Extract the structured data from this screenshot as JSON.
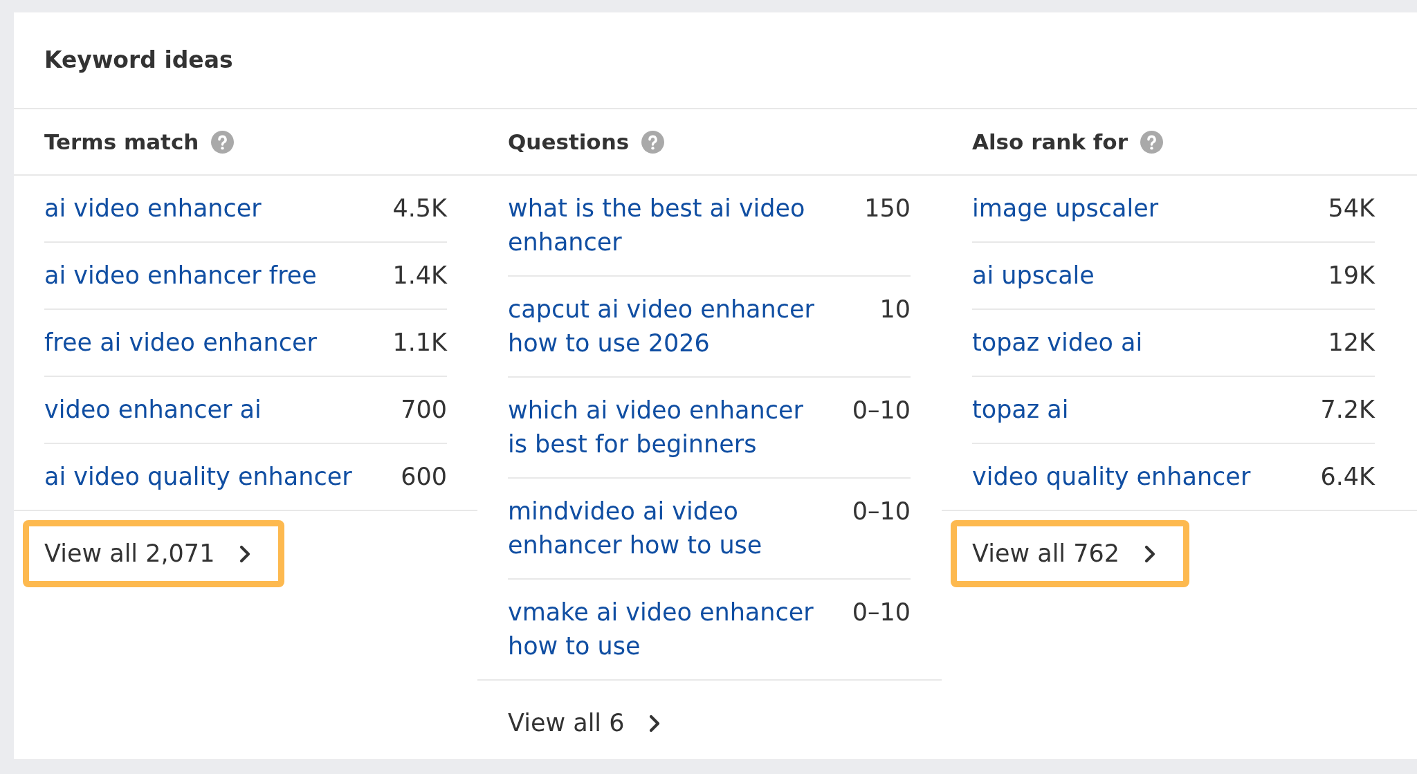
{
  "panel": {
    "title": "Keyword ideas"
  },
  "sections": [
    {
      "title": "Terms match",
      "rows": [
        {
          "keyword": "ai video enhancer",
          "volume": "4.5K"
        },
        {
          "keyword": "ai video enhancer free",
          "volume": "1.4K"
        },
        {
          "keyword": "free ai video enhancer",
          "volume": "1.1K"
        },
        {
          "keyword": "video enhancer ai",
          "volume": "700"
        },
        {
          "keyword": "ai video quality enhancer",
          "volume": "600"
        }
      ],
      "view_all": {
        "label": "View all 2,071",
        "highlighted": true
      }
    },
    {
      "title": "Questions",
      "rows": [
        {
          "keyword": "what is the best ai video enhancer",
          "volume": "150"
        },
        {
          "keyword": "capcut ai video enhancer how to use 2026",
          "volume": "10"
        },
        {
          "keyword": "which ai video enhancer is best for beginners",
          "volume": "0–10"
        },
        {
          "keyword": "mindvideo ai video enhancer how to use",
          "volume": "0–10"
        },
        {
          "keyword": "vmake ai video enhancer how to use",
          "volume": "0–10"
        }
      ],
      "view_all": {
        "label": "View all 6",
        "highlighted": false
      }
    },
    {
      "title": "Also rank for",
      "rows": [
        {
          "keyword": "image upscaler",
          "volume": "54K"
        },
        {
          "keyword": "ai upscale",
          "volume": "19K"
        },
        {
          "keyword": "topaz video ai",
          "volume": "12K"
        },
        {
          "keyword": "topaz ai",
          "volume": "7.2K"
        },
        {
          "keyword": "video quality enhancer",
          "volume": "6.4K"
        }
      ],
      "view_all": {
        "label": "View all 762",
        "highlighted": true
      }
    }
  ]
}
